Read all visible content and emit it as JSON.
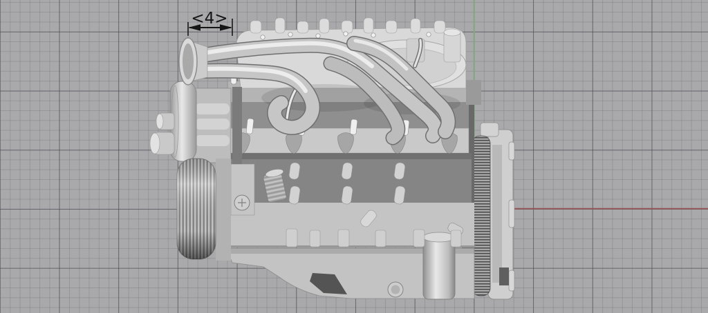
{
  "scene": {
    "background_color": "#a9a9ab",
    "grid_minor_color": "#96969a",
    "grid_major_color": "#77777b"
  },
  "axes": {
    "y_axis_color": "#7fa87f",
    "x_axis_color": "#935757"
  },
  "dimension": {
    "label": "<4>",
    "color": "#161616"
  }
}
